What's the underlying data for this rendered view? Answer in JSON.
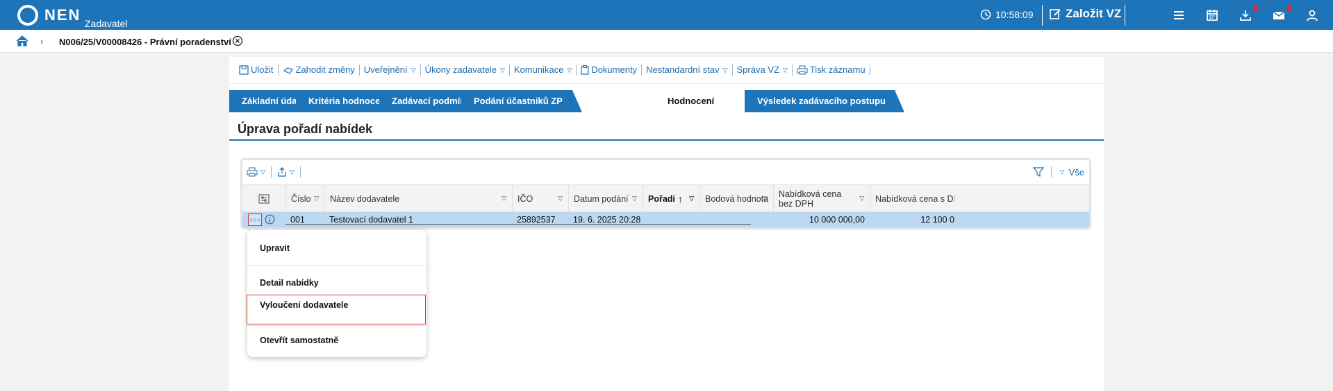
{
  "topbar": {
    "logo": "NEN",
    "subtitle": "Zadavatel",
    "time": "10:58:09",
    "create_label": "Založit VZ",
    "icons": [
      "clock-icon",
      "edit-icon",
      "hamburger-menu-icon",
      "calendar-icon",
      "download-icon",
      "mail-icon",
      "user-icon"
    ],
    "notification_color": "#e3262f",
    "brand_color": "#1e74b8"
  },
  "breadcrumb": {
    "title": "N006/25/V00008426 - Právní poradenství"
  },
  "toolbar": {
    "items": [
      {
        "label": "Uložit",
        "icon": "save-icon"
      },
      {
        "label": "Zahodit změny",
        "icon": "undo-icon"
      },
      {
        "label": "Uveřejnění",
        "dropdown": true
      },
      {
        "label": "Úkony zadavatele",
        "dropdown": true
      },
      {
        "label": "Komunikace",
        "dropdown": true
      },
      {
        "label": "Dokumenty",
        "icon": "clipboard-icon"
      },
      {
        "label": "Nestandardní stav",
        "dropdown": true
      },
      {
        "label": "Správa VZ",
        "dropdown": true
      },
      {
        "label": "Tisk záznamu",
        "icon": "print-icon"
      }
    ]
  },
  "tabs": [
    {
      "label": "Základní údaje"
    },
    {
      "label": "Kritéria hodnocení"
    },
    {
      "label": "Zadávací podmínky"
    },
    {
      "label": "Podání účastníků ZP"
    },
    {
      "label": "Hodnocení",
      "active": true
    },
    {
      "label": "Výsledek zadávacího postupu"
    }
  ],
  "section_title": "Úprava pořadí nabídek",
  "grid": {
    "filter_label": "Vše",
    "columns": [
      "Číslo",
      "Název dodavatele",
      "IČO",
      "Datum podání",
      "Pořadí",
      "Bodová hodnota",
      "Nabídková cena bez DPH",
      "Nabídková cena s DPH"
    ],
    "sorted_column": "Pořadí",
    "rows": [
      {
        "cislo": "001",
        "nazev": "Testovací dodavatel 1",
        "ico": "25892537",
        "datum": "19. 6. 2025 20:28",
        "poradi": "",
        "bodova": "",
        "cena_bez": "10 000 000,00",
        "cena_s": "12 100 0"
      }
    ]
  },
  "context_menu": {
    "items": [
      "Upravit",
      "Detail nabídky",
      "Vyloučení dodavatele",
      "Otevřít samostatně"
    ]
  }
}
